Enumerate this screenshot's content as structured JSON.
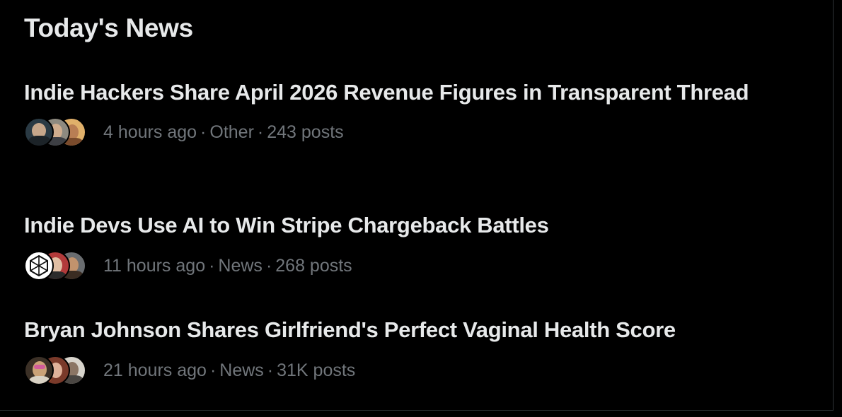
{
  "section": {
    "title": "Today's News"
  },
  "news": [
    {
      "headline": "Indie Hackers Share April 2026 Revenue Figures in Transparent Thread",
      "time": "4 hours ago",
      "category": "Other",
      "posts": "243 posts"
    },
    {
      "headline": "Indie Devs Use AI to Win Stripe Chargeback Battles",
      "time": "11 hours ago",
      "category": "News",
      "posts": "268 posts"
    },
    {
      "headline": "Bryan Johnson Shares Girlfriend's Perfect Vaginal Health Score",
      "time": "21 hours ago",
      "category": "News",
      "posts": "31K posts"
    }
  ],
  "colors": {
    "background": "#000000",
    "headline": "#e7e9ea",
    "meta": "#71767b",
    "divider": "#2f3336"
  }
}
